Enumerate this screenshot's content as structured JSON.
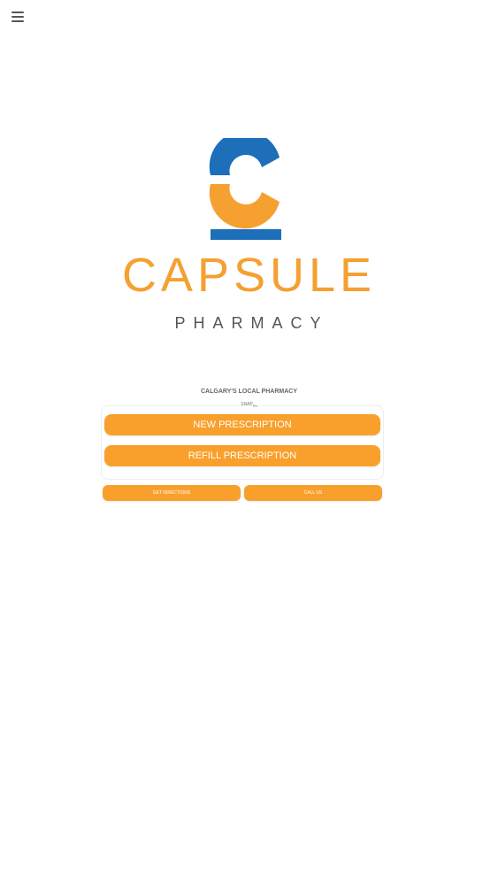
{
  "nav": {
    "menu_icon": "hamburger-menu-icon"
  },
  "brand": {
    "logo_icon": "capsule-c-logo",
    "name": "CAPSULE",
    "sub": "PHARMACY",
    "colors": {
      "blue": "#1c6fb8",
      "orange": "#f5a031",
      "gray": "#555555"
    }
  },
  "main": {
    "tagline": "CALGARY'S LOCAL PHARMACY",
    "snap_label": "SNAP",
    "snap_sub": "Rx",
    "new_prescription": "NEW PRESCRIPTION",
    "refill_prescription": "REFILL PRESCRIPTION",
    "get_directions": "GET DIRECTIONS",
    "call_us": "CALL US",
    "button_color": "#f9a02c"
  }
}
